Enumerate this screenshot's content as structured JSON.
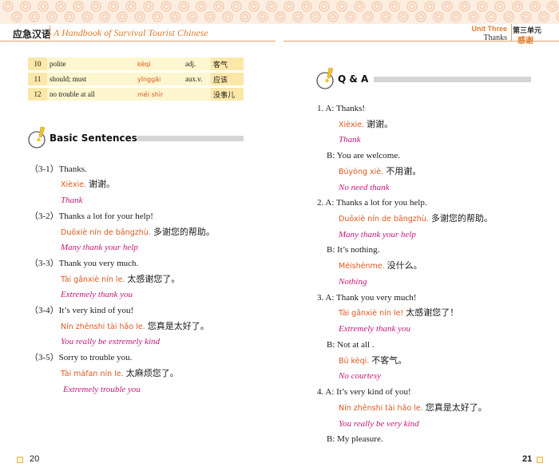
{
  "header": {
    "left_cn": "应急汉语",
    "left_en": "A Handbook of Survival Tourist Chinese",
    "unit_en": "Unit Three",
    "unit_cn": "第三单元",
    "topic_en": "Thanks",
    "topic_cn": "感谢"
  },
  "vocab": [
    {
      "num": "10",
      "meaning": "polite",
      "pinyin": "kèqi",
      "pos": "adj.",
      "cn": "客气"
    },
    {
      "num": "11",
      "meaning": "should; must",
      "pinyin": "yīnggāi",
      "pos": "aux.v.",
      "cn": "应该"
    },
    {
      "num": "12",
      "meaning": "no trouble at all",
      "pinyin": "méi shìr",
      "pos": "",
      "cn": "没事儿"
    }
  ],
  "basic": {
    "title": "Basic Sentences:",
    "items": [
      {
        "label": "（3-1）",
        "en": "Thanks.",
        "pinyin": "Xièxie.",
        "cn": "谢谢。",
        "tr": "Thank"
      },
      {
        "label": "（3-2）",
        "en": "Thanks a lot for your help!",
        "pinyin": "Duōxiè nín de bāngzhù.",
        "cn": "多谢您的帮助。",
        "tr": "Many thank your help"
      },
      {
        "label": "（3-3）",
        "en": "Thank you very much.",
        "pinyin": "Tài gǎnxiè nín le.",
        "cn": "太感谢您了。",
        "tr": "Extremely thank you"
      },
      {
        "label": "（3-4）",
        "en": "It’s very kind of you!",
        "pinyin": "Nín zhēnshi tài hǎo le.",
        "cn": "您真是太好了。",
        "tr": "You really be extremely kind"
      },
      {
        "label": "（3-5）",
        "en": "Sorry to trouble you.",
        "pinyin": "Tài máfan nín le.",
        "cn": "太麻烦您了。",
        "tr": "Extremely trouble you"
      }
    ]
  },
  "qa": {
    "title": "Q & A",
    "items": [
      {
        "label": "1. A:",
        "en": "Thanks!",
        "pinyin": "Xièxie.",
        "cn": "谢谢。",
        "tr": "Thank"
      },
      {
        "label": "B:",
        "en": "You are welcome.",
        "pinyin": "Búyòng xiè.",
        "cn": "不用谢。",
        "tr": "No need thank"
      },
      {
        "label": "2. A:",
        "en": "Thanks a lot for you help.",
        "pinyin": "Duōxiè nín de bāngzhù.",
        "cn": "多谢您的帮助。",
        "tr": "Many thank your help"
      },
      {
        "label": "B:",
        "en": "It’s nothing.",
        "pinyin": "Méishénme.",
        "cn": "没什么。",
        "tr": "Nothing"
      },
      {
        "label": "3. A:",
        "en": "Thank you very much!",
        "pinyin": "Tài gǎnxiè nín le!",
        "cn": "太感谢您了！",
        "tr": "Extremely thank you"
      },
      {
        "label": "B:",
        "en": "Not at all .",
        "pinyin": "Bú kèqi.",
        "cn": "不客气。",
        "tr": "No courtesy"
      },
      {
        "label": "4. A:",
        "en": "It’s very kind of you!",
        "pinyin": "Nín zhēnshi tài hǎo le.",
        "cn": "您真是太好了。",
        "tr": "You really be very kind"
      },
      {
        "label": "B:",
        "en": "My pleasure.",
        "pinyin": "",
        "cn": "",
        "tr": ""
      }
    ]
  },
  "footer": {
    "left_page": "20",
    "right_page": "21"
  },
  "colors": {
    "accent": "#e07d2c",
    "pinyin": "#e0561c",
    "translation": "#c2187a",
    "table_light": "#fdf6cf",
    "table_dark": "#fbe7a8"
  }
}
